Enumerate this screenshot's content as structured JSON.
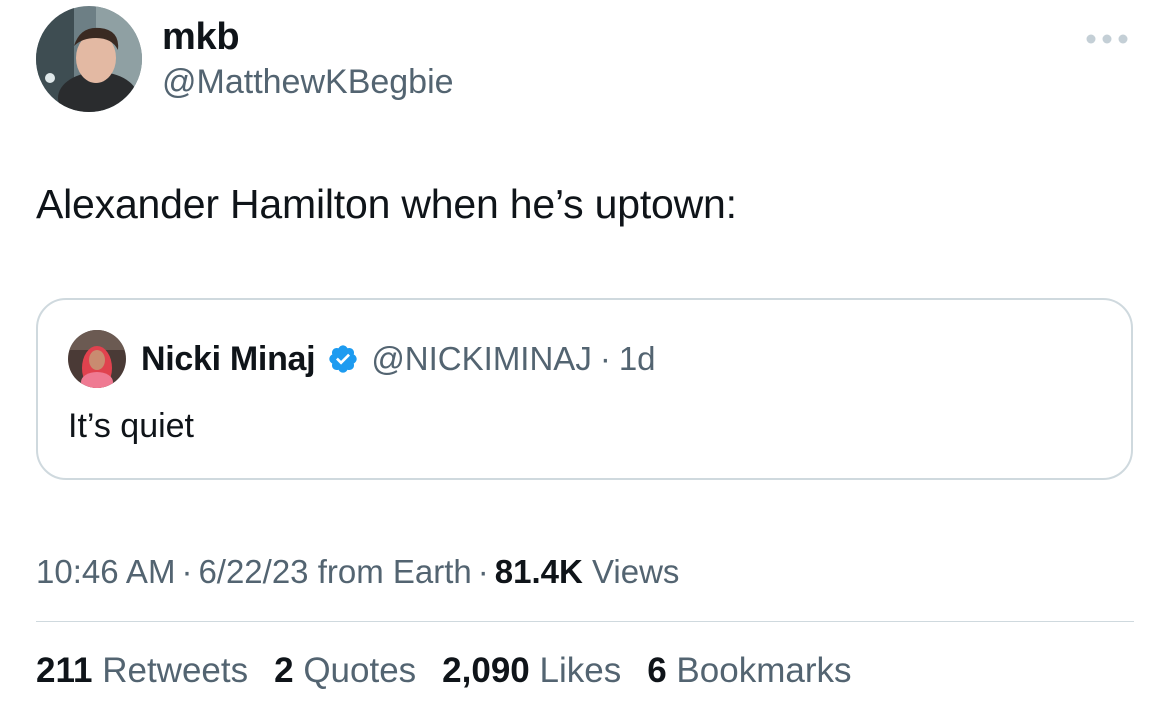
{
  "author": {
    "display_name": "mkb",
    "handle": "@MatthewKBegbie"
  },
  "tweet": {
    "text": "Alexander Hamilton when he’s uptown:"
  },
  "quoted": {
    "display_name": "Nicki Minaj",
    "handle": "@NICKIMINAJ",
    "separator": "·",
    "time": "1d",
    "text": "It’s quiet",
    "verified_color": "#1d9bf0"
  },
  "meta": {
    "time": "10:46 AM",
    "date": "6/22/23",
    "source": "from Earth",
    "separator": "·",
    "views_count": "81.4K",
    "views_label": "Views"
  },
  "stats": {
    "retweets": {
      "count": "211",
      "label": "Retweets"
    },
    "quotes": {
      "count": "2",
      "label": "Quotes"
    },
    "likes": {
      "count": "2,090",
      "label": "Likes"
    },
    "bookmarks": {
      "count": "6",
      "label": "Bookmarks"
    }
  },
  "icons": {
    "more": "more-horizontal-icon",
    "verified": "verified-badge-icon"
  }
}
